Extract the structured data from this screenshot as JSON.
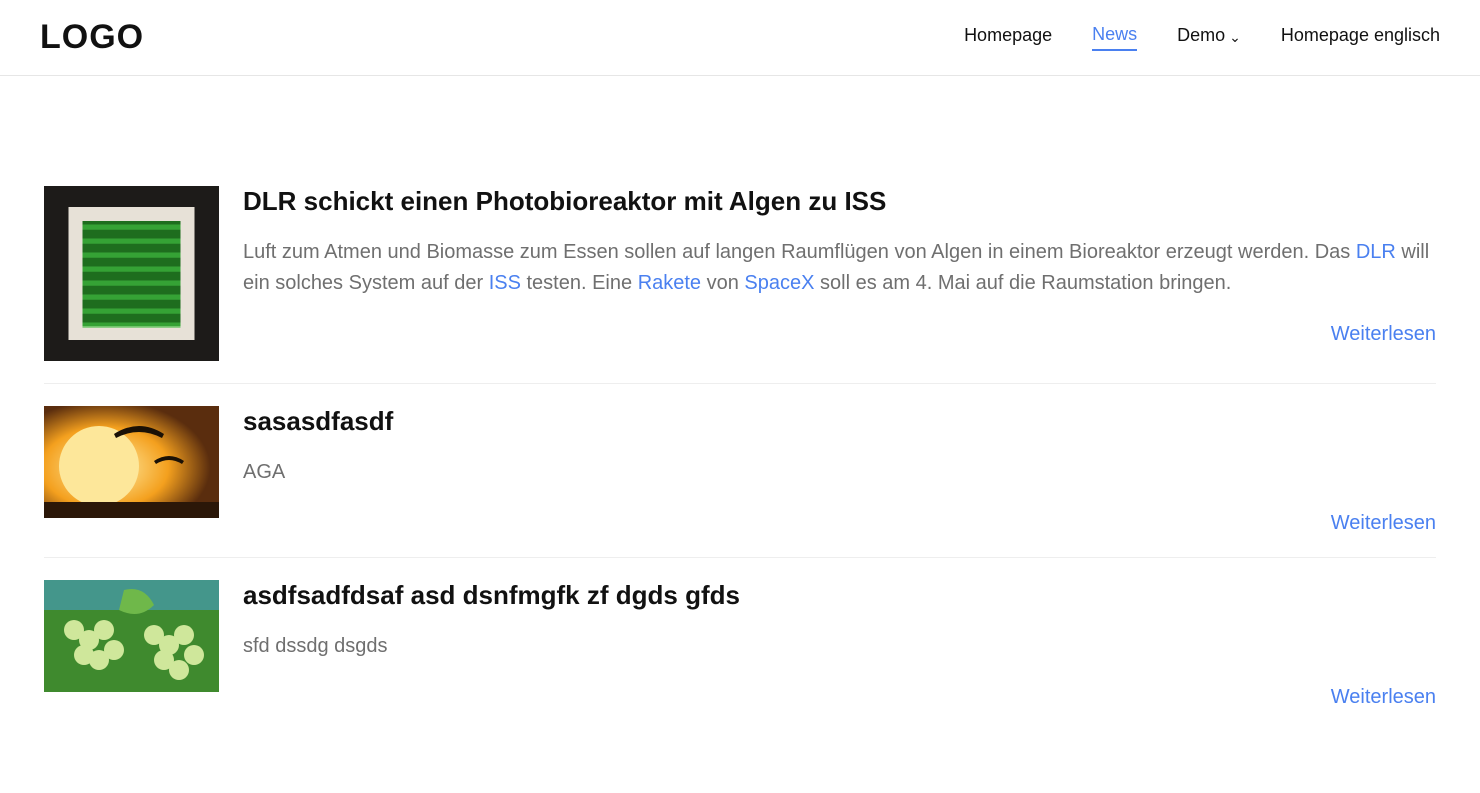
{
  "brand": "LOGO",
  "nav": {
    "items": [
      {
        "label": "Homepage",
        "active": false,
        "hasDropdown": false
      },
      {
        "label": "News",
        "active": true,
        "hasDropdown": false
      },
      {
        "label": "Demo",
        "active": false,
        "hasDropdown": true
      },
      {
        "label": "Homepage englisch",
        "active": false,
        "hasDropdown": false
      }
    ]
  },
  "articles": [
    {
      "title": "DLR schickt einen Photobioreaktor mit Algen zu ISS",
      "imageKind": "reactor",
      "imageTall": true,
      "readMoreLabel": "Weiterlesen",
      "excerptParts": [
        {
          "text": "Luft zum Atmen und Biomasse zum Essen sollen auf langen Raumflügen von Algen in einem Bioreaktor erzeugt werden. Das "
        },
        {
          "text": "DLR",
          "link": true
        },
        {
          "text": " will ein solches System auf der "
        },
        {
          "text": "ISS",
          "link": true
        },
        {
          "text": " testen. Eine "
        },
        {
          "text": "Rakete",
          "link": true
        },
        {
          "text": " von "
        },
        {
          "text": "SpaceX",
          "link": true
        },
        {
          "text": " soll es am 4. Mai auf die Raumstation bringen."
        }
      ]
    },
    {
      "title": "sasasdfasdf",
      "imageKind": "sunset",
      "imageTall": false,
      "readMoreLabel": "Weiterlesen",
      "excerptParts": [
        {
          "text": "AGA"
        }
      ]
    },
    {
      "title": "asdfsadfdsaf asd dsnfmgfk zf dgds gfds",
      "imageKind": "grapes",
      "imageTall": false,
      "readMoreLabel": "Weiterlesen",
      "excerptParts": [
        {
          "text": "sfd dssdg dsgds"
        }
      ]
    }
  ]
}
